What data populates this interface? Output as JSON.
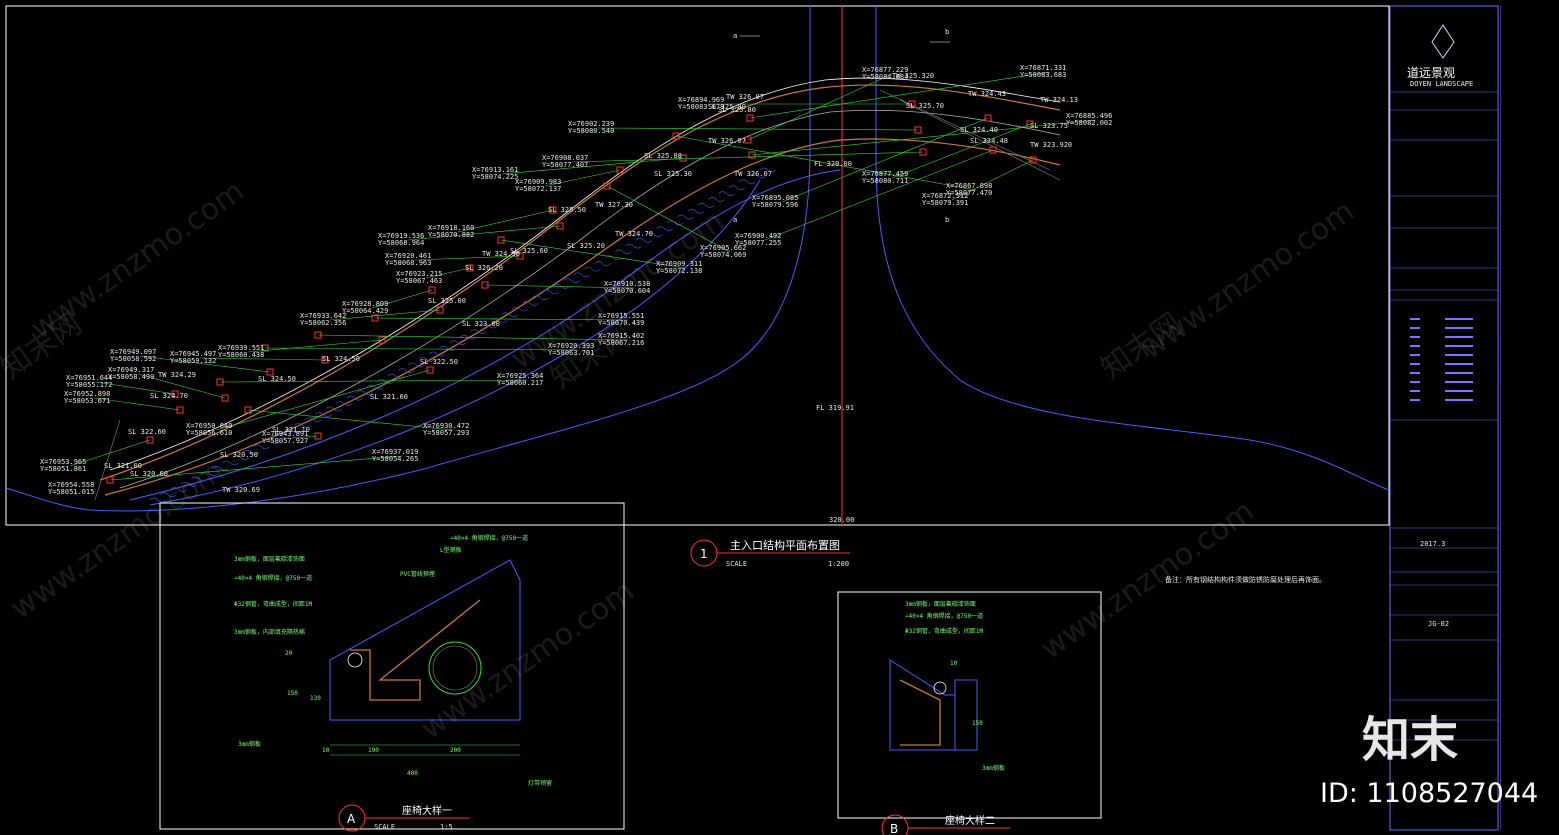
{
  "plan": {
    "title": "主入口结构平面布置图",
    "number": "1",
    "scale_label": "SCALE",
    "scale_value": "1:200",
    "fl_top": "FL 320.00",
    "fl_mid": "FL 319.91",
    "level_bottom": "320.00",
    "section_a": "a",
    "section_b": "b"
  },
  "coords": [
    "X=76871.331",
    "Y=58083.683",
    "X=76877.229",
    "Y=58084.684",
    "X=76885.496",
    "Y=58082.002",
    "X=76894.969",
    "Y=58083.079",
    "X=76902.239",
    "Y=58080.540",
    "X=76908.037",
    "Y=58077.407",
    "X=76895.085",
    "Y=58079.596",
    "X=76900.492",
    "Y=58077.255",
    "X=76877.459",
    "Y=58080.711",
    "X=76872.512",
    "Y=58079.391",
    "X=76867.898",
    "Y=58077.470",
    "X=76913.161",
    "Y=58074.225",
    "X=76909.983",
    "Y=58072.137",
    "X=76905.662",
    "Y=58074.069",
    "X=76918.160",
    "Y=58070.882",
    "X=76919.536",
    "Y=58068.964",
    "X=76909.311",
    "Y=58072.138",
    "X=76920.461",
    "Y=58068.963",
    "X=76923.215",
    "Y=58067.463",
    "X=76910.538",
    "Y=58070.604",
    "X=76928.809",
    "Y=58064.429",
    "X=76933.642",
    "Y=58062.356",
    "X=76915.551",
    "Y=58070.439",
    "X=76939.551",
    "Y=58060.438",
    "X=76915.402",
    "Y=58067.216",
    "X=76945.497",
    "Y=58059.132",
    "X=76920.393",
    "Y=58063.701",
    "X=76949.097",
    "Y=58058.592",
    "X=76925.364",
    "Y=58060.217",
    "X=76949.317",
    "Y=58058.499",
    "X=76951.644",
    "Y=58055.172",
    "X=76952.898",
    "Y=58053.671",
    "X=76950.640",
    "Y=58056.610",
    "X=76943.891",
    "Y=58057.927",
    "X=76930.472",
    "Y=58057.293",
    "X=76953.965",
    "Y=58051.861",
    "X=76937.019",
    "Y=58054.265",
    "X=76954.558",
    "Y=58051.015"
  ],
  "levels": [
    "TW 326.07",
    "SL 325.80",
    "TW 326.07",
    "SL 325.80",
    "TW 324.43",
    "SL 324.48",
    "TW 324.13",
    "SL 325.70",
    "SL 323.75",
    "TW 323.920",
    "SL 325.30",
    "TW 326.07",
    "SL 325.80",
    "TW 327.30",
    "SL 325.50",
    "TW 324.70",
    "SL 325.60",
    "SL 325.20",
    "TW 324.90",
    "SL 326.20",
    "SL 325.00",
    "SL 324.50",
    "SL 323.00",
    "SL 322.50",
    "TW 324.29",
    "SL 324.70",
    "SL 324.50",
    "SL 321.60",
    "SL 322.60",
    "SL 321.00",
    "SL 320.60",
    "SL 320.50",
    "TW 320.69",
    "SL 321.10",
    "TW 325.320",
    "SL 324.40"
  ],
  "details": {
    "a": {
      "letter": "A",
      "title": "座椅大样一",
      "scale": "SCALE",
      "scale_value": "1:5",
      "dims": [
        "20",
        "150",
        "130",
        "10",
        "190",
        "200",
        "400"
      ],
      "notes": [
        "3mm钢板，面层氟碳漆饰面",
        "∠40×4 角钢焊接，@750一道",
        "Φ32钢管，弯曲成型，间距1M",
        "3mm钢板，内部填充隔热棉",
        "3mm钢板",
        "∠40×4 角钢焊接，@750一道",
        "L型钢板",
        "PVC管线预埋",
        "灯带预留"
      ]
    },
    "b": {
      "letter": "B",
      "title": "座椅大样二",
      "dims": [
        "10",
        "150"
      ],
      "notes": [
        "3mm钢板，面层氟碳漆饰面",
        "∠40×4 角钢焊接，@750一道",
        "Φ32钢管，弯曲成型，间距1M",
        "3mm钢板"
      ]
    }
  },
  "note_text": "备注：所有钢结构构件须做防锈防腐处理后再饰面。",
  "title_block": {
    "company": "道远景观",
    "company_en": "DOYEN LANDSCAPE",
    "date": "2017.3",
    "drawing_no": "JG-02"
  },
  "watermark": {
    "site": "www.znzmo.com",
    "brand": "知末网",
    "logo_text": "知末",
    "id_text": "ID: 1108527044"
  }
}
